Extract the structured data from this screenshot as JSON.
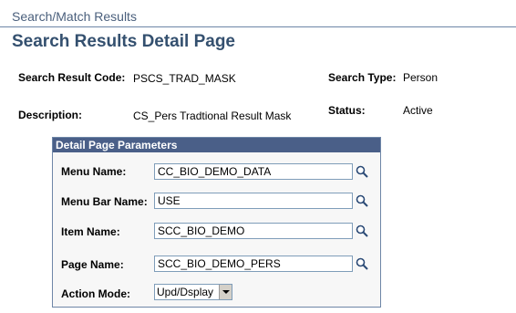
{
  "breadcrumb": "Search/Match Results",
  "page_title": "Search Results Detail Page",
  "summary": {
    "search_result_code_label": "Search Result Code:",
    "search_result_code_value": "PSCS_TRAD_MASK",
    "search_type_label": "Search Type:",
    "search_type_value": "Person",
    "description_label": "Description:",
    "description_value": "CS_Pers Tradtional Result Mask",
    "status_label": "Status:",
    "status_value": "Active"
  },
  "parameters": {
    "header": "Detail Page Parameters",
    "menu_name_label": "Menu Name:",
    "menu_name_value": "CC_BIO_DEMO_DATA",
    "menu_bar_name_label": "Menu Bar Name:",
    "menu_bar_name_value": "USE",
    "item_name_label": "Item Name:",
    "item_name_value": "SCC_BIO_DEMO",
    "page_name_label": "Page Name:",
    "page_name_value": "SCC_BIO_DEMO_PERS",
    "action_mode_label": "Action Mode:",
    "action_mode_value": "Upd/Dsplay"
  },
  "icons": {
    "lookup": "magnifier-lookup-icon",
    "dropdown": "chevron-down-icon"
  },
  "colors": {
    "header_bg": "#4a5f88",
    "title": "#34506f",
    "border": "#6e86a7"
  }
}
